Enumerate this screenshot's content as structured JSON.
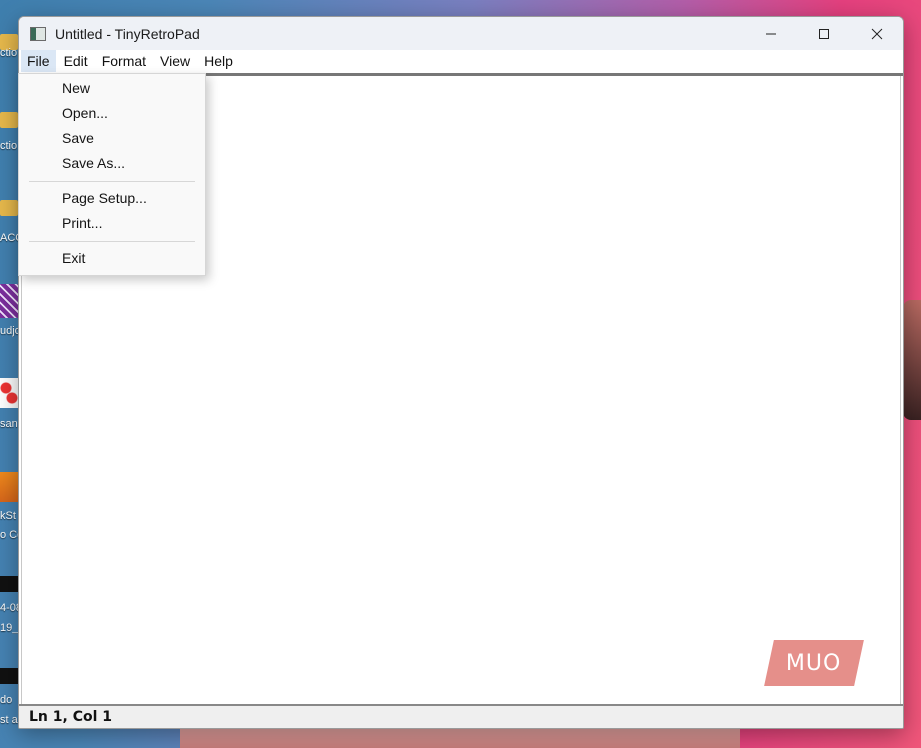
{
  "window": {
    "title": "Untitled - TinyRetroPad",
    "app_icon": "notepad-icon",
    "caption_buttons": [
      "minimize-icon",
      "maximize-icon",
      "close-icon"
    ]
  },
  "menubar": {
    "items": [
      "File",
      "Edit",
      "Format",
      "View",
      "Help"
    ],
    "open_menu": "File"
  },
  "file_menu": {
    "groups": [
      [
        "New",
        "Open...",
        "Save",
        "Save As..."
      ],
      [
        "Page Setup...",
        "Print..."
      ],
      [
        "Exit"
      ]
    ]
  },
  "editor": {
    "content": ""
  },
  "statusbar": {
    "position": "Ln 1, Col 1"
  },
  "watermark": {
    "text": "MUO"
  },
  "desktop": {
    "labels": [
      "ctio",
      "ctio",
      "ACC",
      "udjo",
      "san",
      "kSt",
      "o Co",
      "4-08",
      "19_",
      "do",
      "st a"
    ]
  },
  "colors": {
    "menu_highlight": "#dbe7f5",
    "watermark": "#e58f8a",
    "titlebar": "#eef1f6"
  }
}
